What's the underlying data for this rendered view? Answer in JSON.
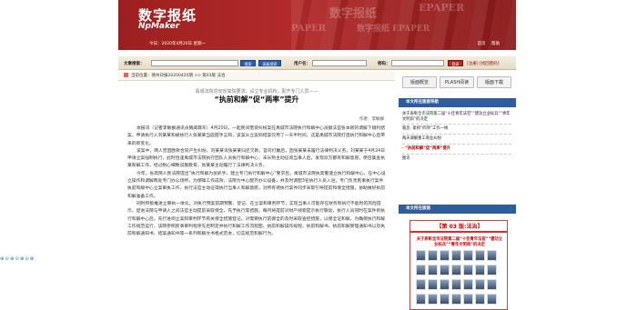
{
  "header": {
    "logo_cn": "数字报纸",
    "logo_en": "NpMaker",
    "date_line": "今日：2020年4月20日 星期一",
    "links": [
      "首页",
      "帮助"
    ],
    "ghost_texts": [
      "数字报纸",
      "EPAPER",
      "PAPER",
      "数字报纸 EPAPER"
    ]
  },
  "search": {
    "article_label": "文章搜索：",
    "search_btn": "搜索",
    "advanced_btn": "高级搜索",
    "user_label": "用户名：",
    "password_label": "密码：",
    "login_btn": "登录",
    "register_link": "[注册] [找回密码]"
  },
  "breadcrumb": "当前位置：德州日报20200420期 >> 第03版 法治",
  "article": {
    "subtitle": "禹城法院贯彻省高院要求，设立专业机构，配齐专门人员——",
    "title": "“执前和解”促“两率”提升",
    "byline": "作者：李敏群",
    "paragraphs": [
      "本报讯（记者李敏群通讯员魏威霖东）4月20日，一起民间借贷纠纷案在禹城市法院执行和解中心员额法官张本新的调解下顺利结案，申请执行人刘某某和被执行人张某某当庭握手言和，该案从立案到结案仅用了一天半时间，这是禹城市法院打造执行和解中心后带来的新变化。",
      "该案中，两人曾因欧款合同产生纠纷，刘某某诉张某某归还欠款，官司打赢后，因张某某未履行法律判决义务，刘某某于4月24日申请立案强制执行，此时恰逢禹城市法院执行团队人员执行和解中心，未长熟主动征询当事人后，发现双方都有和解意愿，便召集查执某和解工作，经过耐心细致说服教育，张某某主动履行了法律判决义务。",
      "今年，省高院人民法院提出“执行和解为总抓手，建立专门执行和解中心”要求后，禹城市法院执高警速立执行和解中心，在中心设立操作和调解两处专门办公场所，为保障工作成效，法院为中心配齐办公设备，并及时调配3名执行人员入驻，专门负责民事执行案件执前和解中心立案审执工作，执行法官主动征得执行当事人和解意愿，对所有待执行案件同步采取引导提前和保全措施，协助做好执前和解准备工作。",
      "同时积极推进立审执一体化，对执行预案前期预警、登记、在立案和审判环节，实现当事人可能存在财务和执行不能时的风险提示，促进法院与申请人之间法官主动提前采取保全，先予执行等措施，每月将提前对财产线索提示执行联动，执行人员同时在案件到执行和解中心后，先行进阅立案和审判环节有关保全措施登记，对需要执行前保全的及时采取查控措施，以保全证和解，为确保执行和解工作规范运行，该院参照民事审判程序先后制定并执行和解工作流程图、执前和解操作规程，执前和解书、执前和解受理通知书以及执前和解通知书、结案通知书等一系列和解文书格式范本，切实规范和解行为。"
    ]
  },
  "sidebar": {
    "buttons": [
      "版面概览",
      "PLASH阅读",
      "版面下载"
    ],
    "nav_header": "本文所在版面导航",
    "nav_items": [
      "关于表彰全市法院第二届“十佳青年法官”“建功立业标兵”“青年文明岗”的决定",
      "临邑: 紧抓“四项”工作一线",
      "两天调解重工商业纠纷",
      "· “执前和解”促“两率”提升",
      "图讯"
    ],
    "page_header": "本文所在版面",
    "thumb_heading": "【第 03 版:法治】",
    "thumb_banner": "关于表彰全市法院第二届“十佳青年法官”“建功立业标兵”“青年文明岗”的决定"
  },
  "left_toolbar": "⊕⊙⊕⊙⊕⊙⊕"
}
